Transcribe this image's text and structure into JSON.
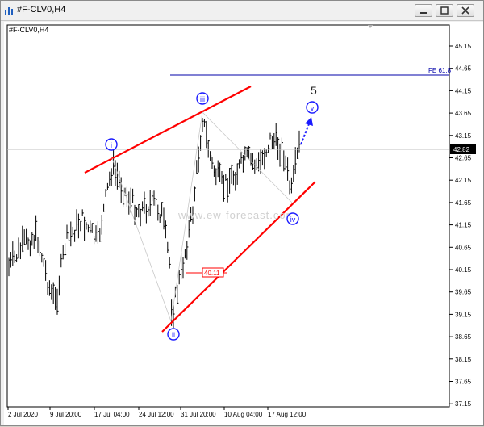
{
  "window": {
    "title": "#F-CLV0,H4",
    "min_icon": "minimize-icon",
    "max_icon": "maximize-icon",
    "close_icon": "close-icon"
  },
  "chart": {
    "label": "#F-CLV0,H4",
    "watermark": "www.ew-forecast.com",
    "current_price": "42.82",
    "fe_label": "FE 61.8",
    "price_box": "40.11",
    "wave_count": "5",
    "wave_labels": [
      "i",
      "ii",
      "iii",
      "iv",
      "v"
    ],
    "colors": {
      "up_trend": "#ff0000",
      "wave": "#1a1aff",
      "fe_line": "#0000aa",
      "bars": "#000000"
    }
  },
  "chart_data": {
    "type": "candlestick",
    "title": "#F-CLV0,H4",
    "y_ticks": [
      "45.15",
      "44.65",
      "44.15",
      "43.65",
      "43.15",
      "42.65",
      "42.15",
      "41.65",
      "41.15",
      "40.65",
      "40.15",
      "39.65",
      "39.15",
      "38.65",
      "38.15",
      "37.65",
      "37.15"
    ],
    "x_ticks": [
      "2 Jul 2020",
      "9 Jul 20:00",
      "17 Jul 04:00",
      "24 Jul 12:00",
      "31 Jul 20:00",
      "10 Aug 04:00",
      "17 Aug 12:00"
    ],
    "ylim": [
      37.0,
      45.4
    ],
    "current_price": 42.82,
    "fe_618_level": 44.45,
    "box_level": 40.11
  }
}
